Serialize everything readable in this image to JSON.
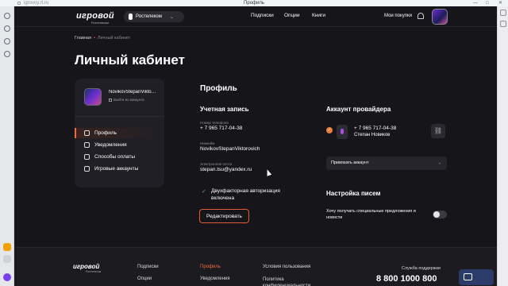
{
  "browser": {
    "url": "igrovoy.rt.ru",
    "tab_title": "Профиль",
    "controls": [
      "—",
      "□",
      "✕"
    ]
  },
  "header": {
    "logo": "игровой",
    "logo_sub": "Ростелеком",
    "provider_select": "Ростелеком",
    "nav": [
      "Подписки",
      "Опции",
      "Книги"
    ],
    "my_purchases": "Мои покупки"
  },
  "breadcrumb": {
    "home": "Главная",
    "current": "Личный кабинет"
  },
  "page_title": "Личный кабинет",
  "sidebar": {
    "username": "NovikovStepanViktor...",
    "logout": "Выйти из аккаунта",
    "items": [
      {
        "label": "Профиль",
        "icon": "user-icon",
        "active": true
      },
      {
        "label": "Уведомления",
        "icon": "bell-icon",
        "active": false
      },
      {
        "label": "Способы оплаты",
        "icon": "card-icon",
        "active": false
      },
      {
        "label": "Игровые аккаунты",
        "icon": "gamepad-icon",
        "active": false
      }
    ]
  },
  "profile": {
    "heading": "Профиль",
    "account_heading": "Учетная запись",
    "phone_label": "Номер телефона",
    "phone": "+ 7 965 717-04-38",
    "nickname_label": "Никнейм",
    "nickname": "NovikovStepanViktorovich",
    "email_label": "Электронная почта",
    "email": "stepan.tsu@yandex.ru",
    "twofa": "Двухфакторная авторизация включена",
    "edit_button": "Редактировать"
  },
  "provider": {
    "heading": "Аккаунт провайдера",
    "phone": "+ 7 965 717-04-38",
    "name": "Степан Новиков",
    "bind_select": "Привязать аккаунт"
  },
  "letters": {
    "heading": "Настройка писем",
    "offers_text": "Хочу получать специальные предложения и новости",
    "offers_enabled": false
  },
  "footer": {
    "logo": "игровой",
    "logo_sub": "Ростелеком",
    "col1": [
      "Подписки",
      "Опции"
    ],
    "col2": [
      "Профиль",
      "Уведомления"
    ],
    "col3": [
      "Условия пользования",
      "Политика конфиденциальности"
    ],
    "support_label": "Служба поддержки",
    "support_phone": "8 800 1000 800"
  },
  "colors": {
    "accent": "#f26a3b",
    "background": "#15151a",
    "card": "#1f1f25",
    "success": "#3fbf6a"
  }
}
